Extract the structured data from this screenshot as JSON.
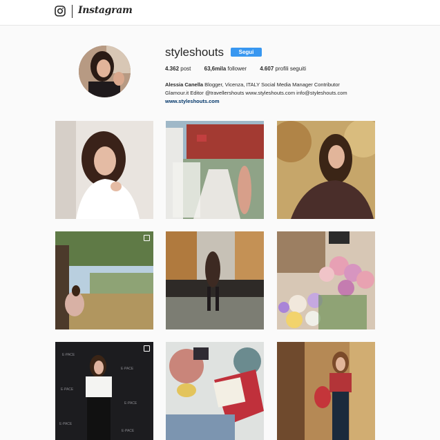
{
  "header": {
    "logo_icon": "instagram-camera-icon",
    "wordmark": "Instagram"
  },
  "profile": {
    "username": "styleshouts",
    "follow_label": "Segui",
    "stats": {
      "posts_value": "4.362",
      "posts_label": "post",
      "followers_value": "63,6mila",
      "followers_label": "follower",
      "following_value": "4.607",
      "following_label": "profili seguiti"
    },
    "bio": {
      "name": "Alessia Canella",
      "line1": "Blogger, Vicenza, ITALY Social Media Manager Contributor",
      "line2": "Glamour.it Editor @travellershouts www.styleshouts.com info@styleshouts.com",
      "website": "www.styleshouts.com"
    }
  },
  "colors": {
    "accent": "#3897f0",
    "link": "#003569",
    "background": "#fafafa"
  },
  "posts": [
    {
      "name": "post-woman-white-sweater"
    },
    {
      "name": "post-red-barn-walkway"
    },
    {
      "name": "post-autumn-floral-blouse"
    },
    {
      "name": "post-field-tree-dress",
      "multi_icon": "multiple-photos-icon"
    },
    {
      "name": "post-bridge-autumn-dress"
    },
    {
      "name": "post-pink-roses-bouquet"
    },
    {
      "name": "post-epace-event",
      "multi_icon": "multiple-photos-icon"
    },
    {
      "name": "post-flatlay-book"
    },
    {
      "name": "post-autumn-woods-overalls"
    }
  ]
}
